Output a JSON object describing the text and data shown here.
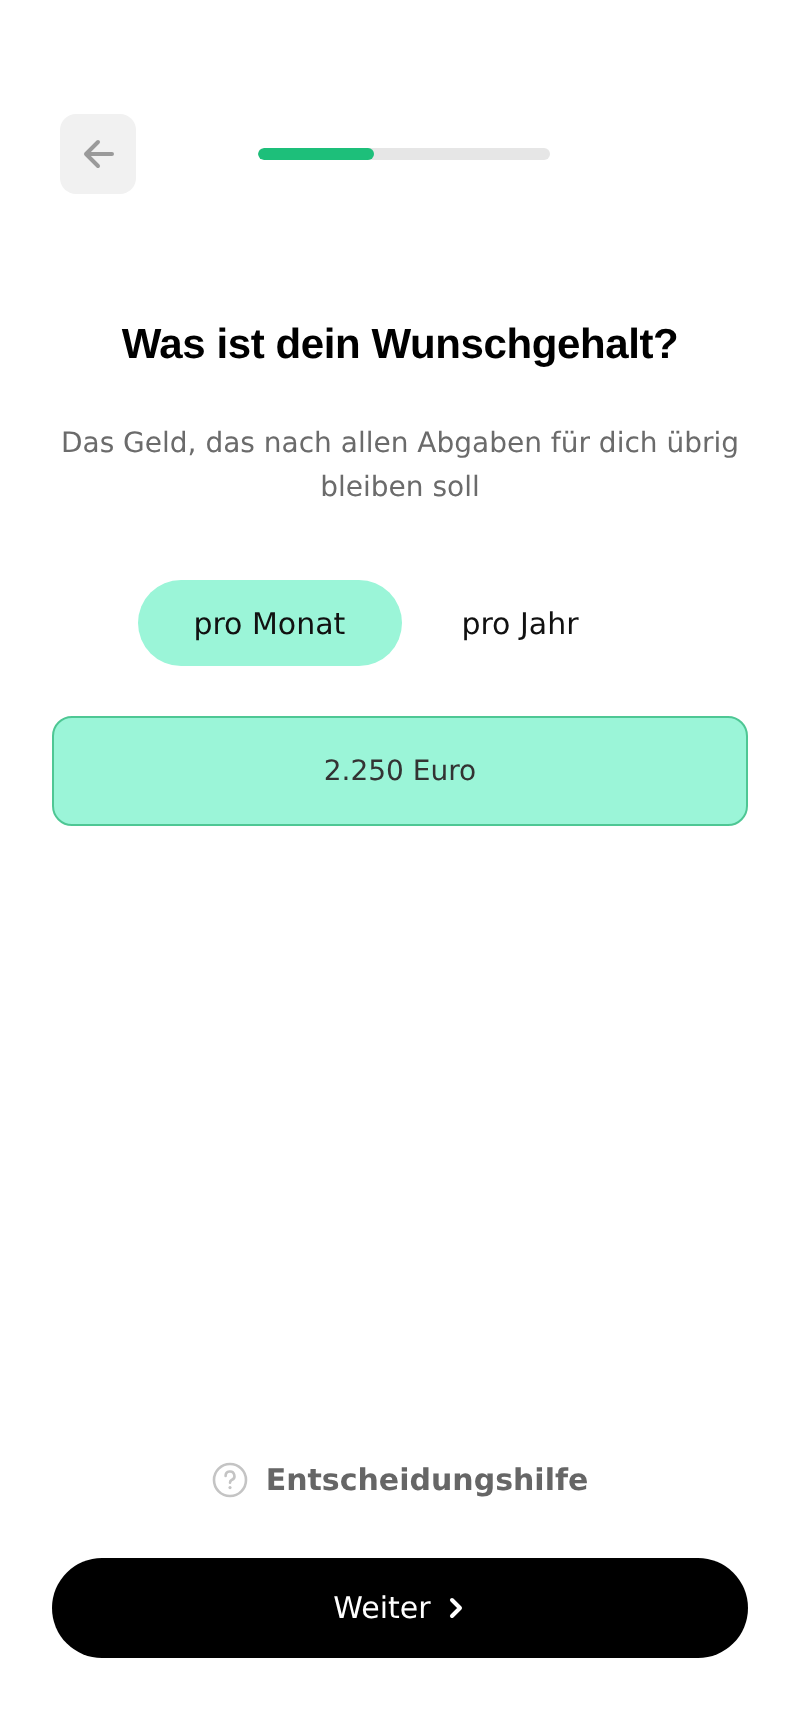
{
  "progress": {
    "level": 0.4
  },
  "title": "Was ist dein Wunschgehalt?",
  "subtitle": "Das Geld, das nach allen Abgaben für dich übrig bleiben soll",
  "period_tabs": [
    {
      "label": "pro Monat",
      "selected": true
    },
    {
      "label": "pro Jahr",
      "selected": false
    }
  ],
  "amount": {
    "value": "2.250 Euro"
  },
  "help_link": "Entscheidungshilfe",
  "next_button": {
    "label": "Weiter"
  }
}
